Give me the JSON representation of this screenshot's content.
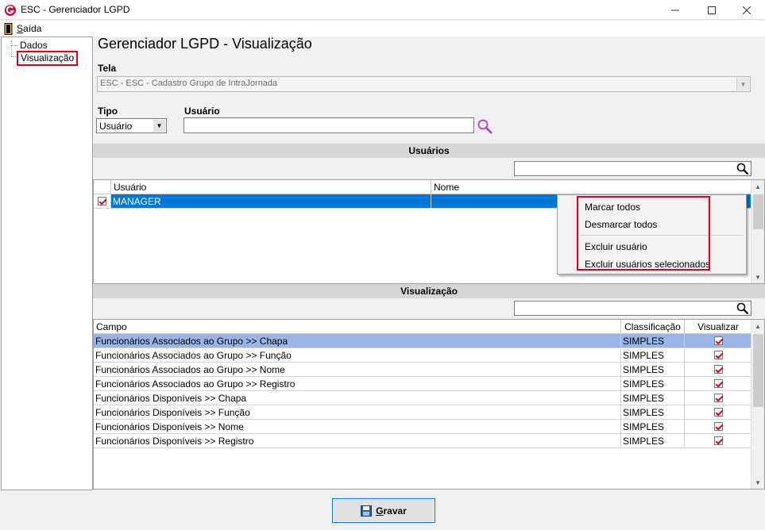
{
  "window": {
    "title": "ESC - Gerenciador LGPD"
  },
  "menu": {
    "saida": "Saída"
  },
  "tree": {
    "items": [
      "Dados",
      "Visualização"
    ]
  },
  "header": {
    "title": "Gerenciador LGPD - Visualização",
    "tela_label": "Tela",
    "tela_value": "ESC - ESC - Cadastro Grupo de IntraJornada",
    "tipo_label": "Tipo",
    "tipo_value": "Usuário",
    "usuario_label": "Usuário",
    "usuario_value": ""
  },
  "usuarios": {
    "header": "Usuários",
    "columns": [
      "Usuário",
      "Nome"
    ],
    "rows": [
      {
        "usuario": "MANAGER",
        "nome": "",
        "checked": true
      }
    ]
  },
  "context_menu": {
    "items": [
      "Marcar todos",
      "Desmarcar todos",
      "Excluir usuário",
      "Excluir usuários selecionados"
    ]
  },
  "visualizacao": {
    "header": "Visualização",
    "columns": [
      "Campo",
      "Classificação",
      "Visualizar"
    ],
    "rows": [
      {
        "campo": "Funcionários Associados ao Grupo >> Chapa",
        "classificacao": "SIMPLES",
        "visualizar": true
      },
      {
        "campo": "Funcionários Associados ao Grupo >> Função",
        "classificacao": "SIMPLES",
        "visualizar": true
      },
      {
        "campo": "Funcionários Associados ao Grupo >> Nome",
        "classificacao": "SIMPLES",
        "visualizar": true
      },
      {
        "campo": "Funcionários Associados ao Grupo >> Registro",
        "classificacao": "SIMPLES",
        "visualizar": true
      },
      {
        "campo": "Funcionários Disponíveis >> Chapa",
        "classificacao": "SIMPLES",
        "visualizar": true
      },
      {
        "campo": "Funcionários Disponíveis >> Função",
        "classificacao": "SIMPLES",
        "visualizar": true
      },
      {
        "campo": "Funcionários Disponíveis >> Nome",
        "classificacao": "SIMPLES",
        "visualizar": true
      },
      {
        "campo": "Funcionários Disponíveis >> Registro",
        "classificacao": "SIMPLES",
        "visualizar": true
      }
    ]
  },
  "footer": {
    "gravar": "Gravar"
  },
  "colors": {
    "selected_row": "#0078d7",
    "highlight_row": "#99b4e6",
    "annotation_red": "#e0001a",
    "search_icon": "#b04fc8"
  }
}
